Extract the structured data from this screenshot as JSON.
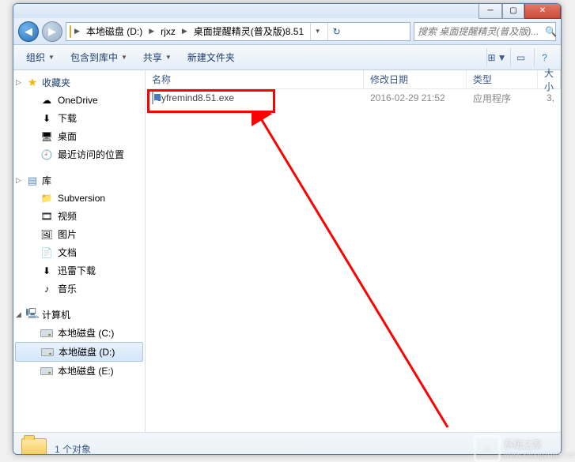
{
  "window": {
    "min_tip": "minimize",
    "max_tip": "maximize",
    "close_tip": "close"
  },
  "nav": {
    "crumbs": [
      "本地磁盘 (D:)",
      "rjxz",
      "桌面提醒精灵(普及版)8.51"
    ],
    "search_placeholder": "搜索 桌面提醒精灵(普及版)..."
  },
  "toolbar": {
    "organize": "组织",
    "include": "包含到库中",
    "share": "共享",
    "newfolder": "新建文件夹"
  },
  "sidebar": {
    "favorites": {
      "label": "收藏夹",
      "items": [
        "OneDrive",
        "下载",
        "桌面",
        "最近访问的位置"
      ]
    },
    "libraries": {
      "label": "库",
      "items": [
        "Subversion",
        "视频",
        "图片",
        "文档",
        "迅雷下载",
        "音乐"
      ]
    },
    "computer": {
      "label": "计算机",
      "items": [
        "本地磁盘 (C:)",
        "本地磁盘 (D:)",
        "本地磁盘 (E:)"
      ]
    }
  },
  "columns": {
    "name": "名称",
    "date": "修改日期",
    "type": "类型",
    "size": "大小"
  },
  "files": [
    {
      "name": "cyfremind8.51.exe",
      "date": "2016-02-29 21:52",
      "type": "应用程序",
      "size": "3,"
    }
  ],
  "status": {
    "count_text": "1 个对象"
  },
  "watermark": {
    "text": "系统之家",
    "url": "www.xitongzhijia.net"
  }
}
